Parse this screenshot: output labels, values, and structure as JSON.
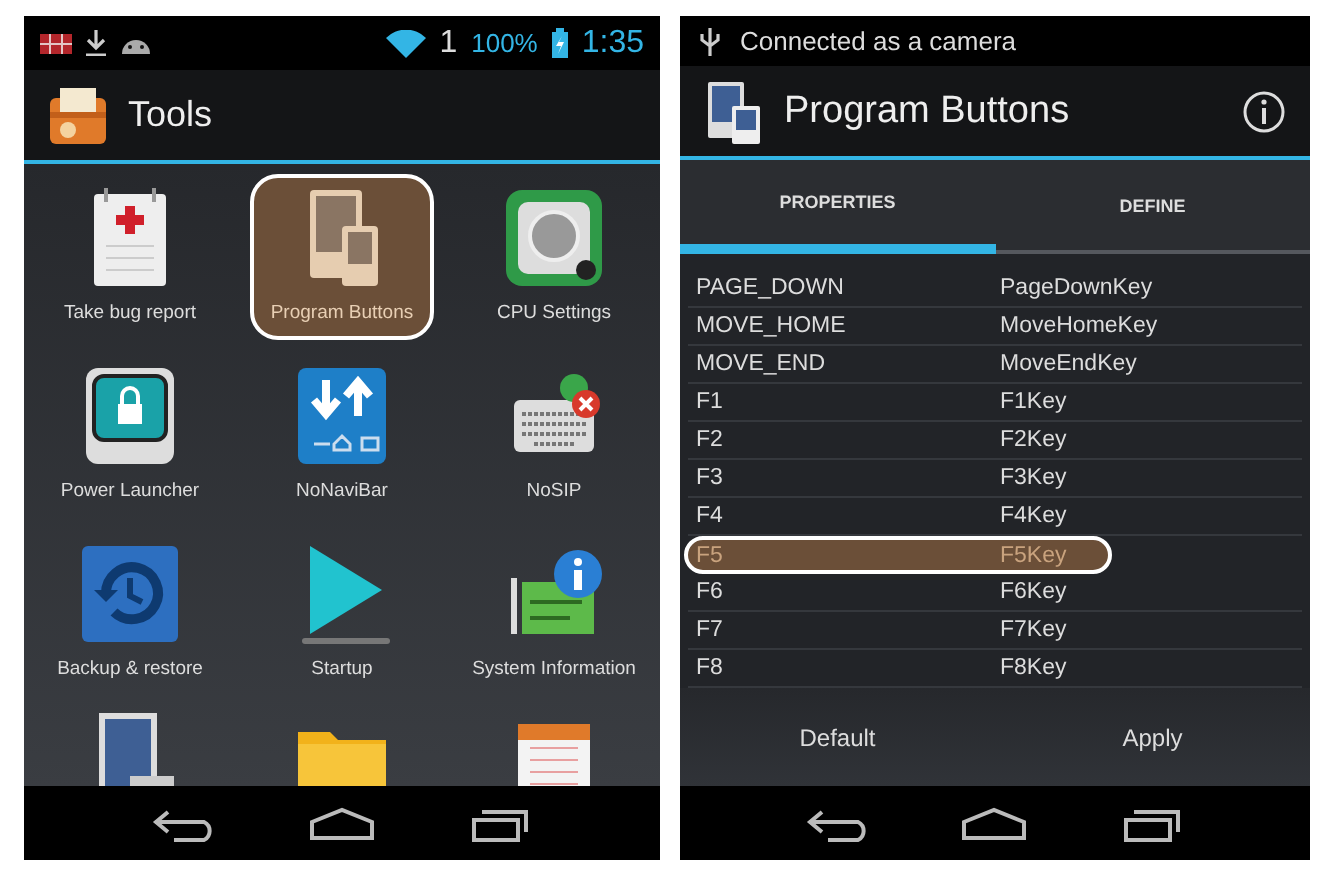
{
  "left_phone": {
    "status_bar": {
      "signal": "1",
      "battery": "100%",
      "time": "1:35"
    },
    "action_bar": {
      "title": "Tools"
    },
    "apps": [
      {
        "label": "Take bug report",
        "selected": false
      },
      {
        "label": "Program Buttons",
        "selected": true
      },
      {
        "label": "CPU Settings",
        "selected": false
      },
      {
        "label": "Power Launcher",
        "selected": false
      },
      {
        "label": "NoNaviBar",
        "selected": false
      },
      {
        "label": "NoSIP",
        "selected": false
      },
      {
        "label": "Backup & restore",
        "selected": false
      },
      {
        "label": "Startup",
        "selected": false
      },
      {
        "label": "System Information",
        "selected": false
      }
    ]
  },
  "right_phone": {
    "status_bar": {
      "notice": "Connected as a camera"
    },
    "action_bar": {
      "title": "Program Buttons"
    },
    "tabs": [
      {
        "label": "PROPERTIES",
        "selected": true
      },
      {
        "label": "DEFINE",
        "selected": false
      }
    ],
    "rows": [
      {
        "name": "PAGE_DOWN",
        "key": "PageDownKey",
        "selected": false
      },
      {
        "name": "MOVE_HOME",
        "key": "MoveHomeKey",
        "selected": false
      },
      {
        "name": "MOVE_END",
        "key": "MoveEndKey",
        "selected": false
      },
      {
        "name": "F1",
        "key": "F1Key",
        "selected": false
      },
      {
        "name": "F2",
        "key": "F2Key",
        "selected": false
      },
      {
        "name": "F3",
        "key": "F3Key",
        "selected": false
      },
      {
        "name": "F4",
        "key": "F4Key",
        "selected": false
      },
      {
        "name": "F5",
        "key": "F5Key",
        "selected": true
      },
      {
        "name": "F6",
        "key": "F6Key",
        "selected": false
      },
      {
        "name": "F7",
        "key": "F7Key",
        "selected": false
      },
      {
        "name": "F8",
        "key": "F8Key",
        "selected": false
      }
    ],
    "buttons": [
      "Default",
      "Apply"
    ]
  }
}
